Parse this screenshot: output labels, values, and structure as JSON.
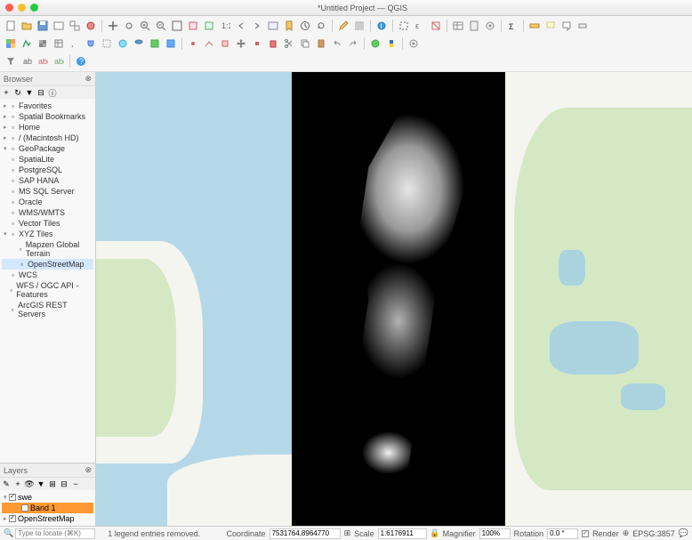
{
  "window": {
    "title": "*Untitled Project — QGIS"
  },
  "browser": {
    "title": "Browser",
    "items": [
      {
        "icon": "star",
        "label": "Favorites",
        "indent": 0,
        "exp": "▸"
      },
      {
        "icon": "bookmark",
        "label": "Spatial Bookmarks",
        "indent": 0,
        "exp": "▸"
      },
      {
        "icon": "home",
        "label": "Home",
        "indent": 0,
        "exp": "▸"
      },
      {
        "icon": "disk",
        "label": "/ (Macintosh HD)",
        "indent": 0,
        "exp": "▸"
      },
      {
        "icon": "gpkg",
        "label": "GeoPackage",
        "indent": 0,
        "exp": "▾"
      },
      {
        "icon": "spatialite",
        "label": "SpatiaLite",
        "indent": 0,
        "exp": ""
      },
      {
        "icon": "pg",
        "label": "PostgreSQL",
        "indent": 0,
        "exp": ""
      },
      {
        "icon": "sap",
        "label": "SAP HANA",
        "indent": 0,
        "exp": ""
      },
      {
        "icon": "mssql",
        "label": "MS SQL Server",
        "indent": 0,
        "exp": ""
      },
      {
        "icon": "oracle",
        "label": "Oracle",
        "indent": 0,
        "exp": ""
      },
      {
        "icon": "wms",
        "label": "WMS/WMTS",
        "indent": 0,
        "exp": ""
      },
      {
        "icon": "vtile",
        "label": "Vector Tiles",
        "indent": 0,
        "exp": ""
      },
      {
        "icon": "xyz",
        "label": "XYZ Tiles",
        "indent": 0,
        "exp": "▾"
      },
      {
        "icon": "xyz",
        "label": "Mapzen Global Terrain",
        "indent": 1,
        "exp": ""
      },
      {
        "icon": "xyz",
        "label": "OpenStreetMap",
        "indent": 1,
        "exp": "",
        "sel": true
      },
      {
        "icon": "wcs",
        "label": "WCS",
        "indent": 0,
        "exp": ""
      },
      {
        "icon": "wfs",
        "label": "WFS / OGC API - Features",
        "indent": 0,
        "exp": ""
      },
      {
        "icon": "arcgis",
        "label": "ArcGIS REST Servers",
        "indent": 0,
        "exp": ""
      }
    ]
  },
  "layers": {
    "title": "Layers",
    "items": [
      {
        "label": "swe",
        "checked": true,
        "expanded": true
      },
      {
        "label": "Band 1",
        "checked": false,
        "indented": true,
        "sel": true
      },
      {
        "label": "OpenStreetMap",
        "checked": true
      }
    ]
  },
  "statusbar": {
    "locator_placeholder": "Type to locate (⌘K)",
    "message": "1 legend entries removed.",
    "coord_label": "Coordinate",
    "coord_value": "7531764,8964770",
    "scale_label": "Scale",
    "scale_value": "1:6176911",
    "magnifier_label": "Magnifier",
    "magnifier_value": "100%",
    "rotation_label": "Rotation",
    "rotation_value": "0.0 °",
    "render_label": "Render",
    "render_checked": true,
    "crs_label": "EPSG:3857"
  },
  "colors": {
    "accent": "#ff9933",
    "sel": "#d4e8ff"
  }
}
